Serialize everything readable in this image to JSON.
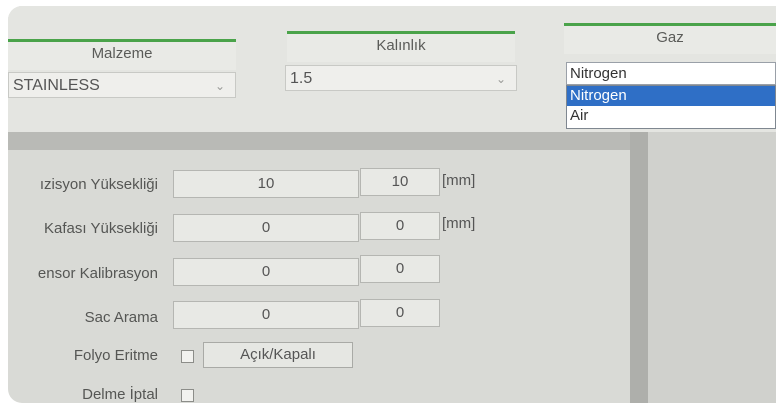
{
  "header": {
    "malzeme_label": "Malzeme",
    "kalinlik_label": "Kalınlık",
    "gaz_label": "Gaz"
  },
  "malzeme": {
    "value": "STAINLESS"
  },
  "kalinlik": {
    "value": "1.5"
  },
  "gaz": {
    "selected": "Nitrogen",
    "options": [
      "Nitrogen",
      "Air"
    ],
    "highlight_color": "#2f6fc6"
  },
  "rows": [
    {
      "label": "ızisyon Yüksekliği",
      "value1": "10",
      "value2": "10",
      "unit": "[mm]"
    },
    {
      "label": "Kafası Yüksekliği",
      "value1": "0",
      "value2": "0",
      "unit": "[mm]"
    },
    {
      "label": "ensor Kalibrasyon",
      "value1": "0",
      "value2": "0"
    },
    {
      "label": "Sac Arama",
      "value1": "0",
      "value2": "0"
    }
  ],
  "folyo": {
    "label": "Folyo Eritme",
    "button_label": "Açık/Kapalı"
  },
  "delme": {
    "label": "Delme İptal"
  },
  "colors": {
    "accent": "#4aa34a",
    "panel": "#d9dad6"
  },
  "icons": {
    "dropdown": "chevron-down-icon"
  }
}
